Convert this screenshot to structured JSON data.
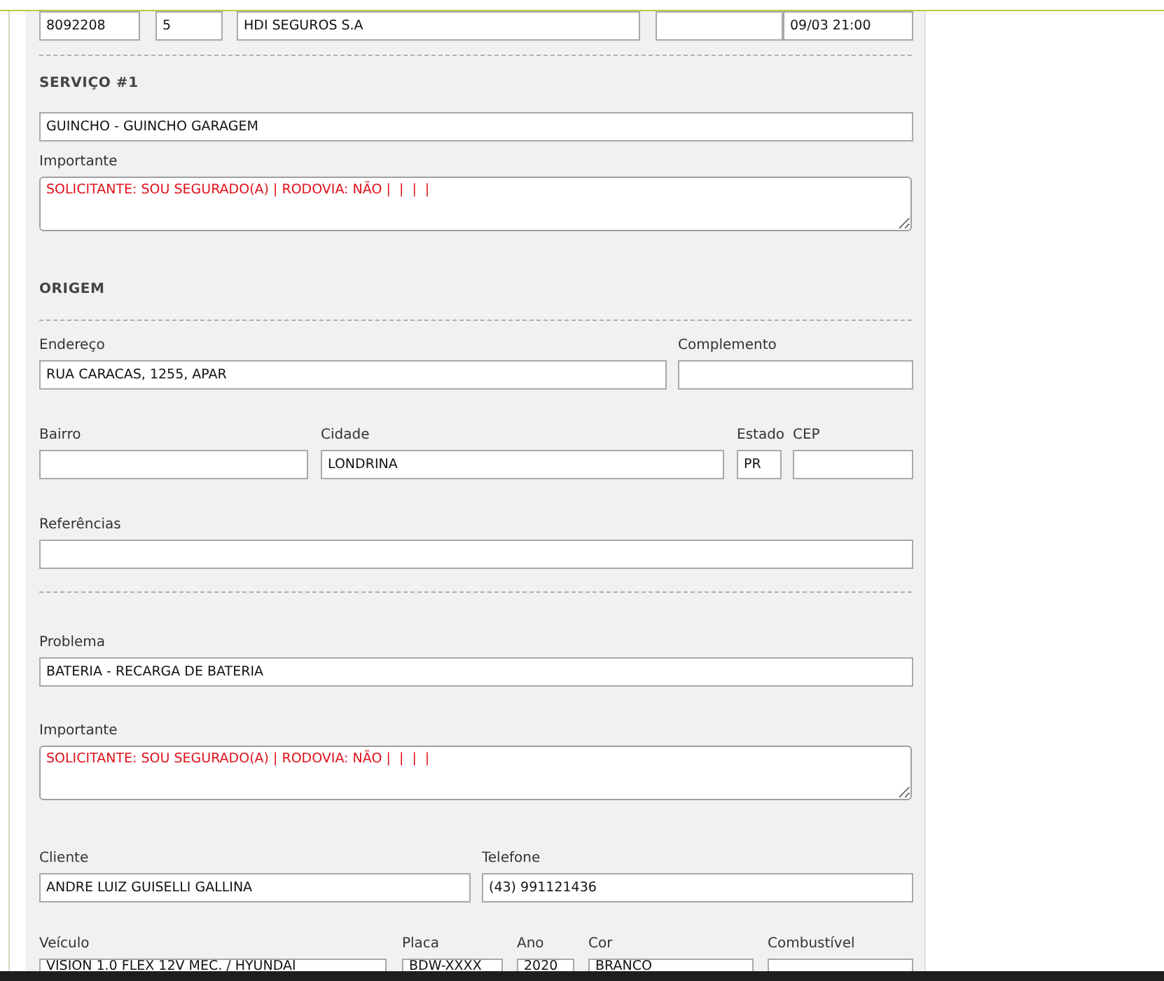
{
  "blocks": [
    {
      "kind": "row",
      "fields": [
        {
          "kind": "input",
          "value": "8092208"
        },
        {
          "kind": "input",
          "value": "5"
        },
        {
          "kind": "input",
          "value": "HDI SEGUROS S.A"
        },
        {
          "kind": "blank"
        },
        {
          "kind": "input",
          "value": "09/03 21:00"
        }
      ]
    },
    {
      "kind": "divider"
    },
    {
      "kind": "heading",
      "text": "SERVIÇO #1"
    },
    {
      "kind": "row",
      "fields": [
        {
          "kind": "input",
          "value": "GUINCHO - GUINCHO GARAGEM"
        }
      ]
    },
    {
      "kind": "textarea",
      "label": "Importante",
      "value": "SOLICITANTE: SOU SEGURADO(A) | RODOVIA: NÃO |  |  |  |"
    },
    {
      "kind": "heading",
      "text": "ORIGEM"
    },
    {
      "kind": "divider"
    },
    {
      "kind": "row",
      "fields": [
        {
          "kind": "input",
          "label": "Endereço",
          "value": "RUA CARACAS, 1255, APAR"
        },
        {
          "kind": "blank",
          "label": "Complemento"
        }
      ]
    },
    {
      "kind": "row",
      "fields": [
        {
          "kind": "blank",
          "label": "Bairro"
        },
        {
          "kind": "input",
          "label": "Cidade",
          "value": "LONDRINA"
        },
        {
          "kind": "input",
          "label": "Estado",
          "value": "PR"
        },
        {
          "kind": "blank",
          "label": "CEP"
        }
      ]
    },
    {
      "kind": "row",
      "fields": [
        {
          "kind": "blank",
          "label": "Referências"
        }
      ]
    },
    {
      "kind": "divider"
    },
    {
      "kind": "row",
      "fields": [
        {
          "kind": "input",
          "label": "Problema",
          "value": "BATERIA - RECARGA DE BATERIA"
        }
      ]
    },
    {
      "kind": "textarea",
      "label": "Importante",
      "value": "SOLICITANTE: SOU SEGURADO(A) | RODOVIA: NÃO |  |  |  |"
    },
    {
      "kind": "row",
      "fields": [
        {
          "kind": "input",
          "label": "Cliente",
          "value": "ANDRE LUIZ GUISELLI GALLINA"
        },
        {
          "kind": "input",
          "label": "Telefone",
          "value": "(43) 991121436"
        }
      ]
    },
    {
      "kind": "row",
      "fields": [
        {
          "kind": "input",
          "label": "Veículo",
          "value": "VISION 1.0 FLEX 12V MEC. / HYUNDAI"
        },
        {
          "kind": "input",
          "label": "Placa",
          "value": "BDW-XXXX"
        },
        {
          "kind": "input",
          "label": "Ano",
          "value": "2020"
        },
        {
          "kind": "input",
          "label": "Cor",
          "value": "BRANCO"
        },
        {
          "kind": "blank",
          "label": "Combustível"
        }
      ]
    }
  ]
}
